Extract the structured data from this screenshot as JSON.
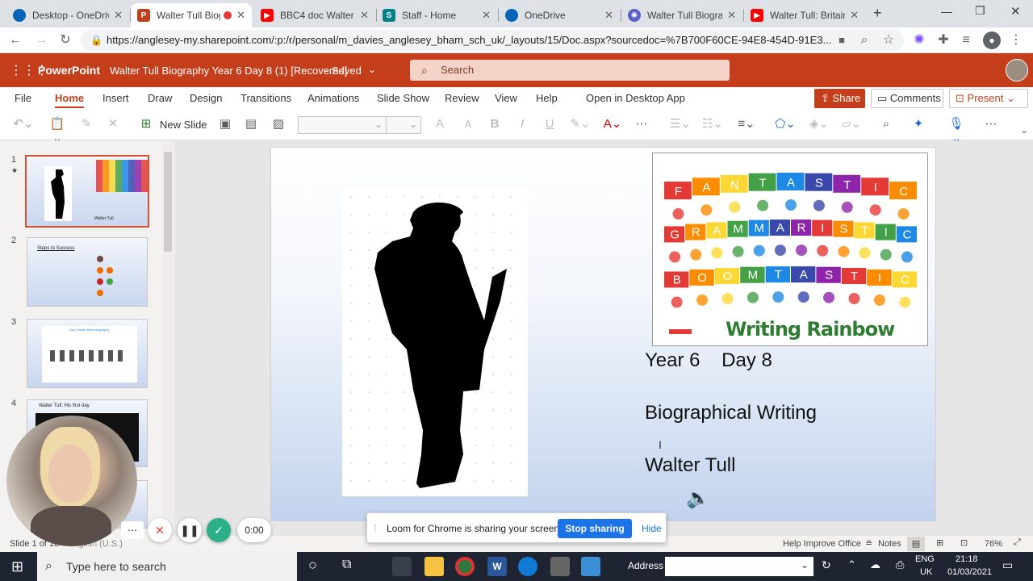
{
  "browser": {
    "tabs": [
      {
        "title": "Desktop - OneDrive",
        "color": "#0364b8",
        "active": false
      },
      {
        "title": "Walter Tull Biography",
        "color": "#c43e1c",
        "active": true
      },
      {
        "title": "BBC4 doc Walter Tull",
        "color": "#ff0000",
        "active": false
      },
      {
        "title": "Staff - Home",
        "color": "#038387",
        "active": false
      },
      {
        "title": "OneDrive",
        "color": "#0364b8",
        "active": false
      },
      {
        "title": "Walter Tull Biography",
        "color": "#5b5fc7",
        "active": false
      },
      {
        "title": "Walter Tull: Britain",
        "color": "#ff0000",
        "active": false
      }
    ],
    "url": "https://anglesey-my.sharepoint.com/:p:/r/personal/m_davies_anglesey_bham_sch_uk/_layouts/15/Doc.aspx?sourcedoc=%7B700F60CE-94E8-454D-91E3..."
  },
  "app": {
    "name": "PowerPoint",
    "doc_title": "Walter Tull Biography Year 6 Day 8 (1) [Recovered]",
    "saved_status": "Saved",
    "search_placeholder": "Search"
  },
  "menu": {
    "items": [
      "File",
      "Home",
      "Insert",
      "Draw",
      "Design",
      "Transitions",
      "Animations",
      "Slide Show",
      "Review",
      "View",
      "Help"
    ],
    "open_desktop": "Open in Desktop App",
    "share": "Share",
    "comments": "Comments",
    "present": "Present"
  },
  "ribbon": {
    "new_slide": "New Slide"
  },
  "thumbnails": [
    {
      "num": "1",
      "caption": "Walter Tull"
    },
    {
      "num": "2",
      "caption": "Steps to Success"
    },
    {
      "num": "3",
      "caption": "Non-Fiction Mind Biography"
    },
    {
      "num": "4",
      "caption": "Walter Tull: His first day"
    }
  ],
  "slide": {
    "line1": "Year 6    Day 8",
    "line2": "Biographical Writing",
    "line3": "Walter Tull",
    "rainbow": {
      "row1": [
        "F",
        "A",
        "N",
        "T",
        "A",
        "S",
        "T",
        "I",
        "C"
      ],
      "row2": [
        "G",
        "R",
        "A",
        "M",
        "M",
        "A",
        "R",
        "I",
        "S",
        "T",
        "I",
        "C"
      ],
      "row3": [
        "B",
        "O",
        "O",
        "M",
        "T",
        "A",
        "S",
        "T",
        "I",
        "C"
      ],
      "title": "Writing Rainbow",
      "colors": [
        "#e53935",
        "#fb8c00",
        "#fdd835",
        "#43a047",
        "#1e88e5",
        "#3949ab",
        "#8e24aa"
      ]
    }
  },
  "status": {
    "slide_counter": "Slide 1 of 18",
    "language": "English (U.S.)",
    "help": "Help Improve Office",
    "notes": "Notes",
    "zoom": "76%"
  },
  "loom": {
    "message": "Loom for Chrome is sharing your screen.",
    "stop": "Stop sharing",
    "hide": "Hide",
    "timer": "0:00"
  },
  "taskbar": {
    "search_placeholder": "Type here to search",
    "address_label": "Address",
    "lang1": "ENG",
    "lang2": "UK",
    "time": "21:18",
    "date": "01/03/2021"
  }
}
